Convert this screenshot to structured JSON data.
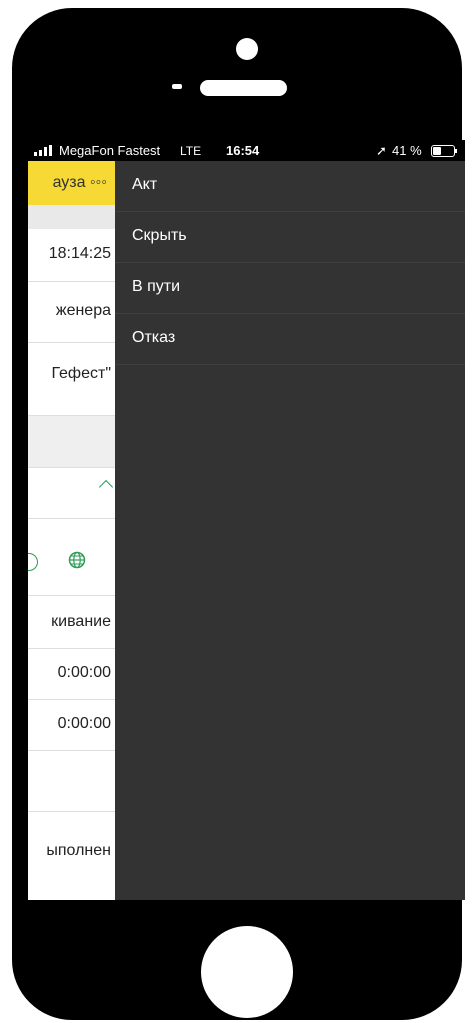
{
  "status_bar": {
    "carrier": "MegaFon Fastest",
    "network": "LTE",
    "time": "16:54",
    "location_glyph": "➚",
    "battery": "41 %"
  },
  "app": {
    "header_title": "ауза ◦◦◦",
    "rows": [
      "18:14:25",
      "женера",
      "Гефест\"",
      "кивание",
      "0:00:00",
      "0:00:00",
      "ыполнен"
    ]
  },
  "menu": {
    "items": [
      "Акт",
      "Скрыть",
      "В пути",
      "Отказ"
    ]
  },
  "colors": {
    "header_yellow": "#f6d935",
    "menu_background": "#333333",
    "accent_green": "#2e9c57"
  }
}
